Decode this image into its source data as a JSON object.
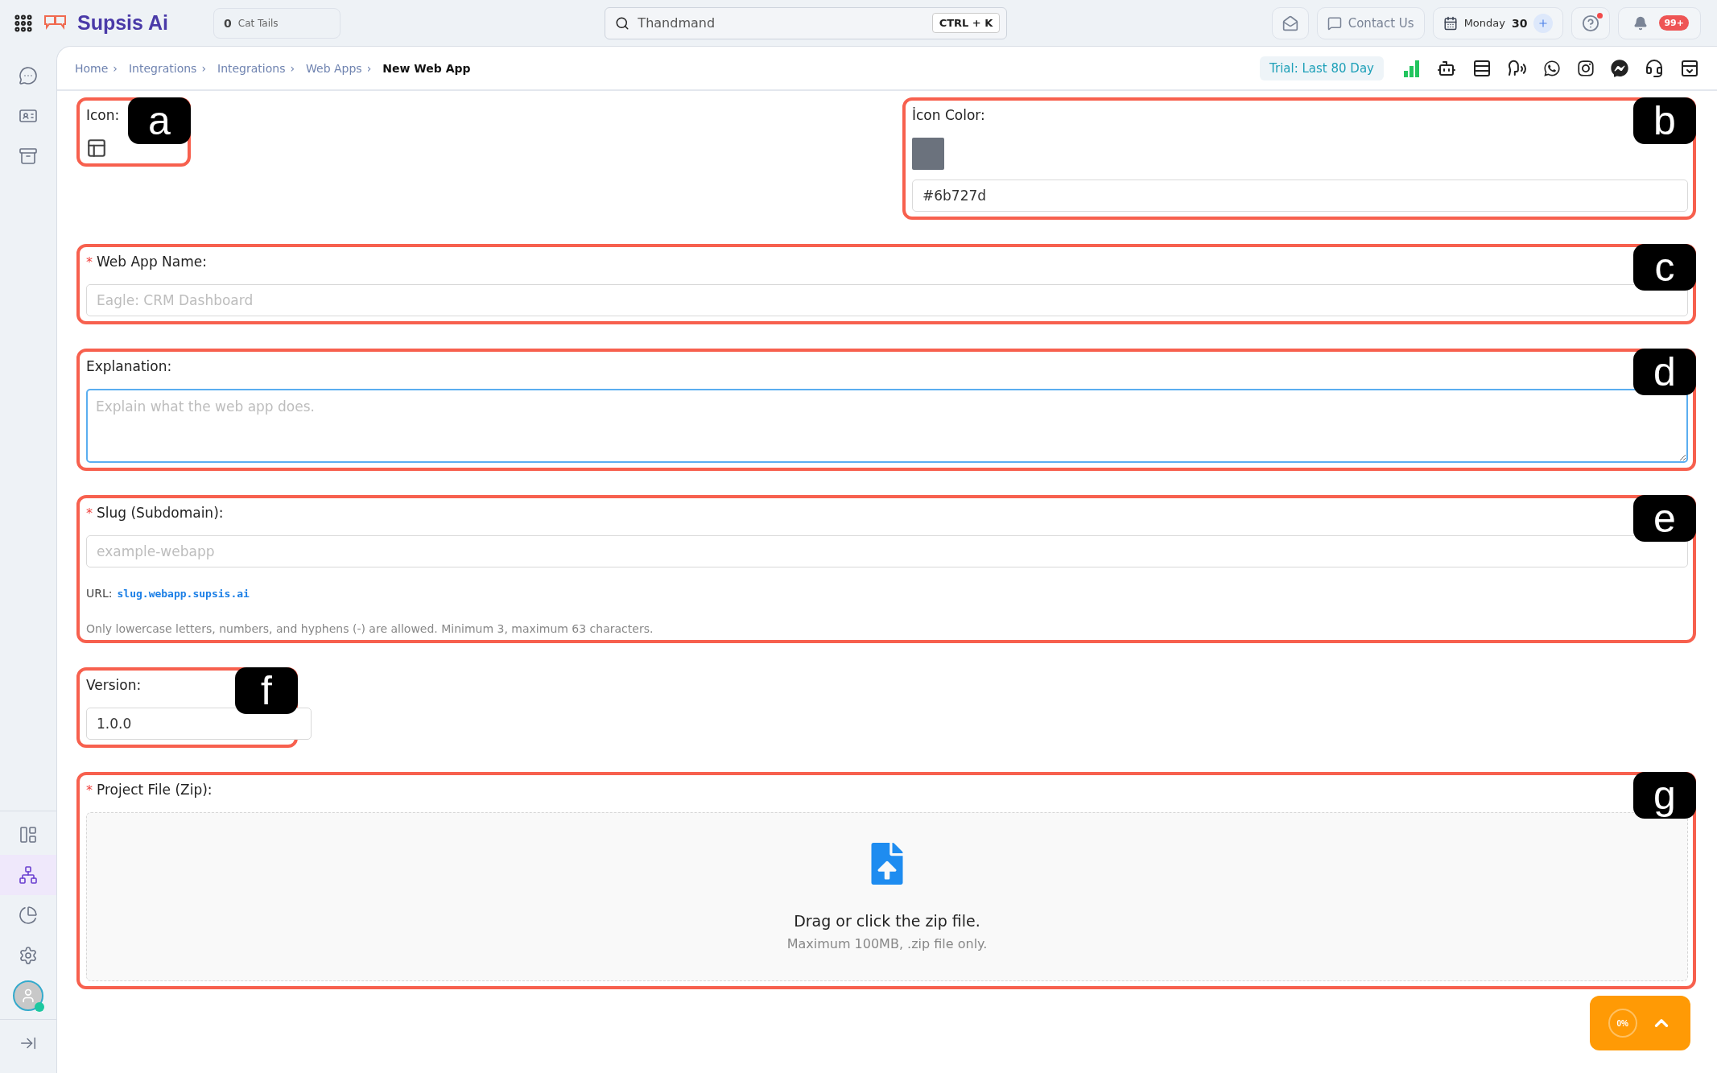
{
  "topbar": {
    "brand": "Supsis Ai",
    "counter": {
      "count": "0",
      "label": "Cat Tails"
    },
    "search": {
      "value": "Thandmand",
      "shortcut": "CTRL + K"
    },
    "contact": "Contact Us",
    "date": {
      "day": "Monday",
      "number": "30"
    },
    "help": {
      "alert": true
    },
    "notifications": "99+"
  },
  "sidebar": {
    "top": [
      {
        "kind": "chat",
        "selected": false
      },
      {
        "kind": "contacts",
        "selected": false
      },
      {
        "kind": "inbox",
        "selected": false
      }
    ],
    "bottom": [
      {
        "kind": "layout",
        "selected": false
      },
      {
        "kind": "integrations",
        "selected": true
      },
      {
        "kind": "reports",
        "selected": false
      },
      {
        "kind": "settings",
        "selected": false
      }
    ],
    "user": {
      "online": true
    }
  },
  "breadcrumbs": {
    "separator": "›",
    "items": [
      {
        "label": "Home",
        "current": false
      },
      {
        "label": "Integrations",
        "current": false
      },
      {
        "label": "Integrations",
        "current": false
      },
      {
        "label": "Web Apps",
        "current": false
      },
      {
        "label": "New Web App",
        "current": true
      }
    ]
  },
  "trial": "Trial: Last 80 Day",
  "form": {
    "sections": [
      {
        "callout": "a",
        "kind": "icon",
        "label": "Icon:"
      },
      {
        "callout": "b",
        "kind": "color",
        "label": "İcon Color:",
        "color": "#6b727d",
        "value": "#6b727d"
      },
      {
        "callout": "c",
        "kind": "text",
        "label": "Web App Name:",
        "required_mark": "*",
        "placeholder": "Eagle: CRM Dashboard"
      },
      {
        "callout": "d",
        "kind": "textarea",
        "label": "Explanation:",
        "placeholder": "Explain what the web app does.",
        "focused": true
      },
      {
        "callout": "e",
        "kind": "slug",
        "label": "Slug (Subdomain):",
        "required_mark": "*",
        "placeholder": "example-webapp",
        "url_label": "URL:",
        "url": "slug.webapp.supsis.ai",
        "hint": "Only lowercase letters, numbers, and hyphens (-) are allowed. Minimum 3, maximum 63 characters."
      },
      {
        "callout": "f",
        "kind": "short",
        "label": "Version:",
        "value": "1.0.0"
      },
      {
        "callout": "g",
        "kind": "upload",
        "label": "Project File (Zip):",
        "required_mark": "*",
        "title": "Drag or click the zip file.",
        "subtitle": "Maximum 100MB, .zip file only."
      }
    ]
  },
  "progress_widget": {
    "percent": "0%"
  }
}
